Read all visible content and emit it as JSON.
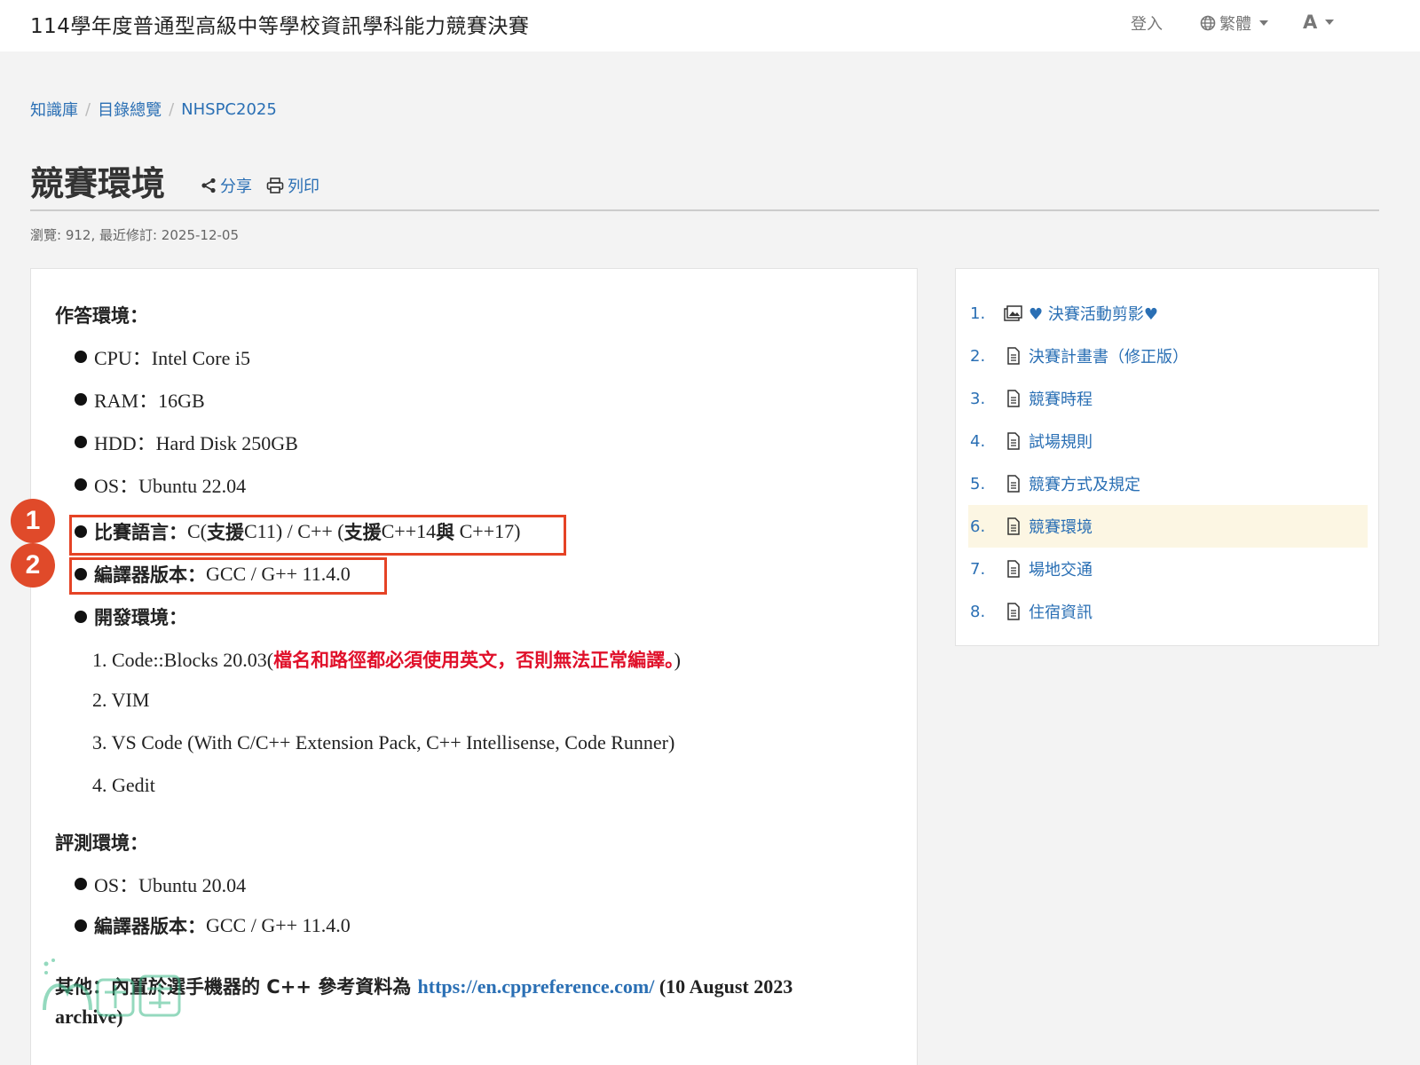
{
  "header": {
    "site_title": "114學年度普通型高級中等學校資訊學科能力競賽決賽",
    "login_label": "登入",
    "language_label": "繁體",
    "font_label": "A"
  },
  "breadcrumb": {
    "items": [
      "知識庫",
      "目錄總覽",
      "NHSPC2025"
    ],
    "separator": "/"
  },
  "page": {
    "title": "競賽環境",
    "share_label": "分享",
    "print_label": "列印",
    "meta": "瀏覽: 912, 最近修訂: 2025-12-05"
  },
  "content": {
    "answer_env_heading": "作答環境：",
    "cpu": "CPU：Intel Core i5",
    "ram": "RAM：16GB",
    "hdd": "HDD：Hard Disk 250GB",
    "os": "OS：Ubuntu 22.04",
    "lang_label": "比賽語言：",
    "lang_value_1": "C(",
    "lang_value_2": "支援",
    "lang_value_3": "C11) / C++ (",
    "lang_value_4": "支援",
    "lang_value_5": "C++14",
    "lang_value_6": "與",
    "lang_value_7": " C++17)",
    "compiler_label": "編譯器版本：",
    "compiler_value": "GCC / G++ 11.4.0",
    "dev_env_label": "開發環境：",
    "dev_1_prefix": "1. Code::Blocks 20.03(",
    "dev_1_warning": "檔名和路徑都必須使用英文，否則無法正常編譯。",
    "dev_1_suffix": ")",
    "dev_2": "2. VIM",
    "dev_3": "3. VS Code (With C/C++ Extension Pack, C++ Intellisense, Code Runner)",
    "dev_4": "4. Gedit",
    "judge_env_heading": "評測環境：",
    "judge_os": "OS：Ubuntu 20.04",
    "judge_compiler_label": "編譯器版本：",
    "judge_compiler_value": "GCC / G++ 11.4.0",
    "other_prefix": "其他：內置於選手機器的 C++ 參考資料為 ",
    "other_link": "https://en.cppreference.com/",
    "other_suffix": " (10 August 2023 archive)",
    "badge_1": "1",
    "badge_2": "2",
    "highlight_color": "#e54325",
    "warning_color": "#e0102a"
  },
  "toc": {
    "items": [
      {
        "num": "1.",
        "label": "♥ 決賽活動剪影♥",
        "icon": "gallery-icon"
      },
      {
        "num": "2.",
        "label": "決賽計畫書（修正版）",
        "icon": "document-icon"
      },
      {
        "num": "3.",
        "label": "競賽時程",
        "icon": "document-icon"
      },
      {
        "num": "4.",
        "label": "試場規則",
        "icon": "document-icon"
      },
      {
        "num": "5.",
        "label": "競賽方式及規定",
        "icon": "document-icon"
      },
      {
        "num": "6.",
        "label": "競賽環境",
        "icon": "document-icon",
        "active": true
      },
      {
        "num": "7.",
        "label": "場地交通",
        "icon": "document-icon"
      },
      {
        "num": "8.",
        "label": "住宿資訊",
        "icon": "document-icon"
      }
    ],
    "link_color": "#2a6fb4",
    "active_bg": "#fcf6e3"
  }
}
